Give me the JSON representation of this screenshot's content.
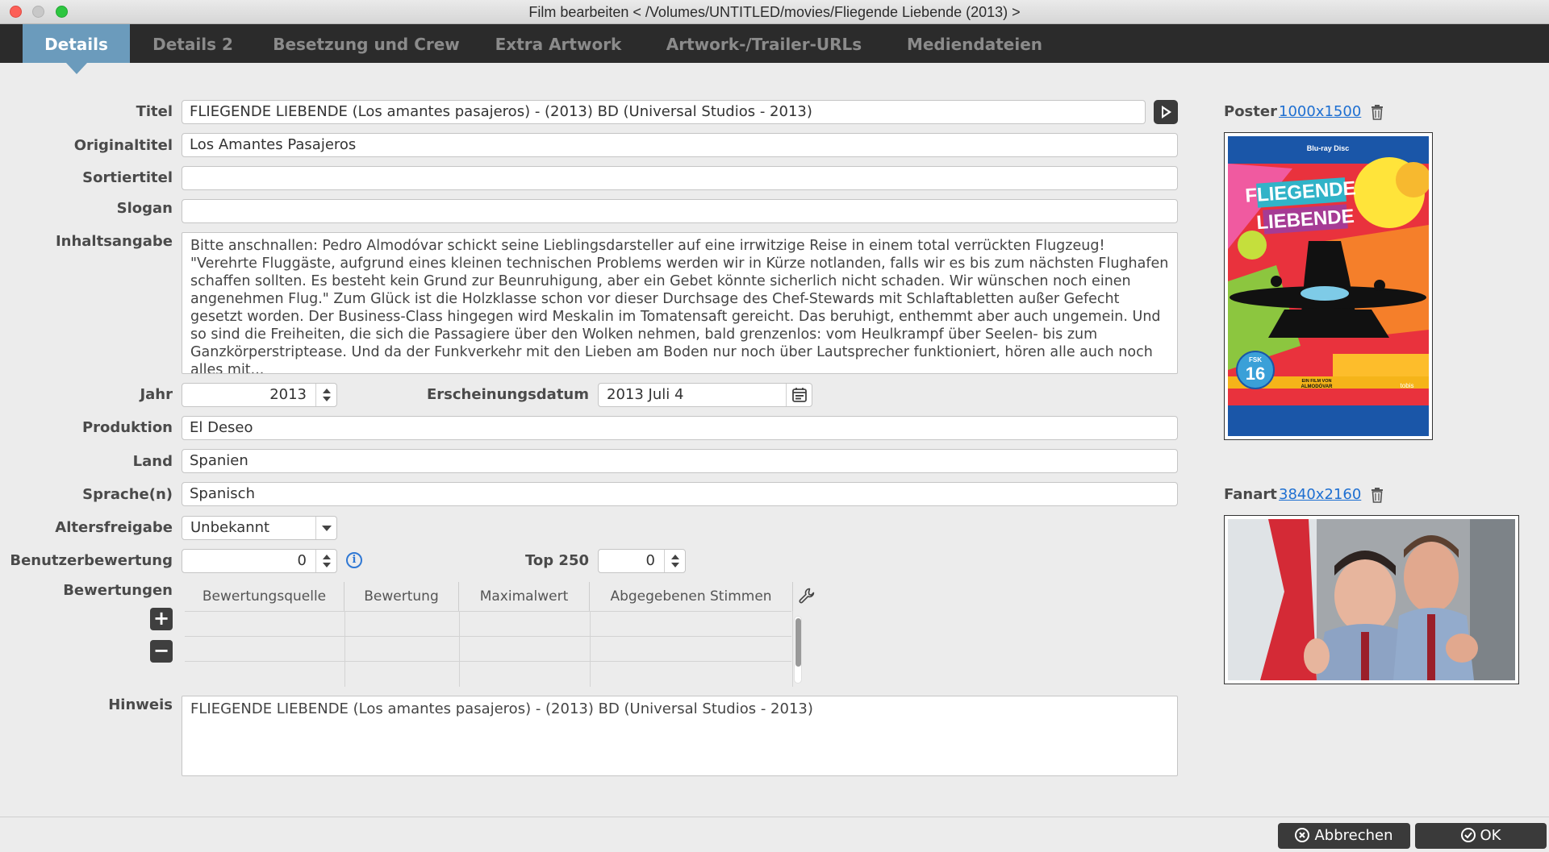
{
  "window": {
    "title": "Film bearbeiten  < /Volumes/UNTITLED/movies/Fliegende Liebende (2013) >"
  },
  "tabs": [
    {
      "label": "Details",
      "active": true
    },
    {
      "label": "Details 2",
      "active": false
    },
    {
      "label": "Besetzung und Crew",
      "active": false
    },
    {
      "label": "Extra Artwork",
      "active": false
    },
    {
      "label": "Artwork-/Trailer-URLs",
      "active": false
    },
    {
      "label": "Mediendateien",
      "active": false
    }
  ],
  "form": {
    "title_label": "Titel",
    "title_value": "FLIEGENDE LIEBENDE (Los amantes pasajeros) - (2013) BD (Universal Studios - 2013)",
    "originaltitle_label": "Originaltitel",
    "originaltitle_value": "Los Amantes Pasajeros",
    "sorttitle_label": "Sortiertitel",
    "sorttitle_value": "",
    "tagline_label": "Slogan",
    "tagline_value": "",
    "plot_label": "Inhaltsangabe",
    "plot_value": "Bitte anschnallen: Pedro Almodóvar schickt seine Lieblingsdarsteller auf eine irrwitzige Reise in einem total verrückten Flugzeug!  \"Verehrte Fluggäste, aufgrund eines kleinen technischen Problems werden wir in Kürze notlanden, falls wir es bis zum nächsten Flughafen schaffen sollten. Es besteht kein Grund zur Beunruhigung, aber ein Gebet könnte sicherlich nicht schaden. Wir wünschen noch einen angenehmen Flug.\" Zum Glück ist die Holzklasse schon vor dieser Durchsage des Chef-Stewards mit Schlaftabletten außer Gefecht gesetzt worden. Der Business-Class hingegen wird Meskalin im Tomatensaft gereicht. Das beruhigt, enthemmt aber auch ungemein. Und so sind die Freiheiten, die sich die Passagiere über den Wolken nehmen, bald grenzenlos: vom Heulkrampf über Seelen- bis zum Ganzkörperstriptease. Und da der Funkverkehr mit den Lieben am Boden nur noch über Lautsprecher funktioniert, hören alle auch noch alles mit...",
    "year_label": "Jahr",
    "year_value": "2013",
    "release_label": "Erscheinungsdatum",
    "release_value": "2013 Juli 4",
    "production_label": "Produktion",
    "production_value": "El Deseo",
    "country_label": "Land",
    "country_value": "Spanien",
    "language_label": "Sprache(n)",
    "language_value": "Spanisch",
    "certification_label": "Altersfreigabe",
    "certification_value": "Unbekannt",
    "userrating_label": "Benutzerbewertung",
    "userrating_value": "0",
    "top250_label": "Top 250",
    "top250_value": "0",
    "ratings_label": "Bewertungen",
    "ratings_columns": [
      "Bewertungsquelle",
      "Bewertung",
      "Maximalwert",
      "Abgegebenen Stimmen"
    ],
    "ratings_add": "+",
    "ratings_remove": "−",
    "note_label": "Hinweis",
    "note_value": "FLIEGENDE LIEBENDE (Los amantes pasajeros) - (2013) BD (Universal Studios - 2013)"
  },
  "artwork": {
    "poster_label": "Poster",
    "poster_size": "1000x1500",
    "fanart_label": "Fanart",
    "fanart_size": "3840x2160",
    "poster_title_1": "FLIEGENDE",
    "poster_title_2": "LIEBENDE",
    "poster_fsk": "16",
    "poster_fsk_label": "FSK",
    "poster_brand": "Blu-ray Disc",
    "poster_director_line": "EIN FILM VON",
    "poster_director": "ALMODÓVAR",
    "poster_label_right": "tobis"
  },
  "footer": {
    "cancel_label": "Abbrechen",
    "ok_label": "OK"
  },
  "colors": {
    "tab_active": "#6b9bbc",
    "tabbar": "#2b2b2b",
    "link": "#1e6fd1"
  }
}
